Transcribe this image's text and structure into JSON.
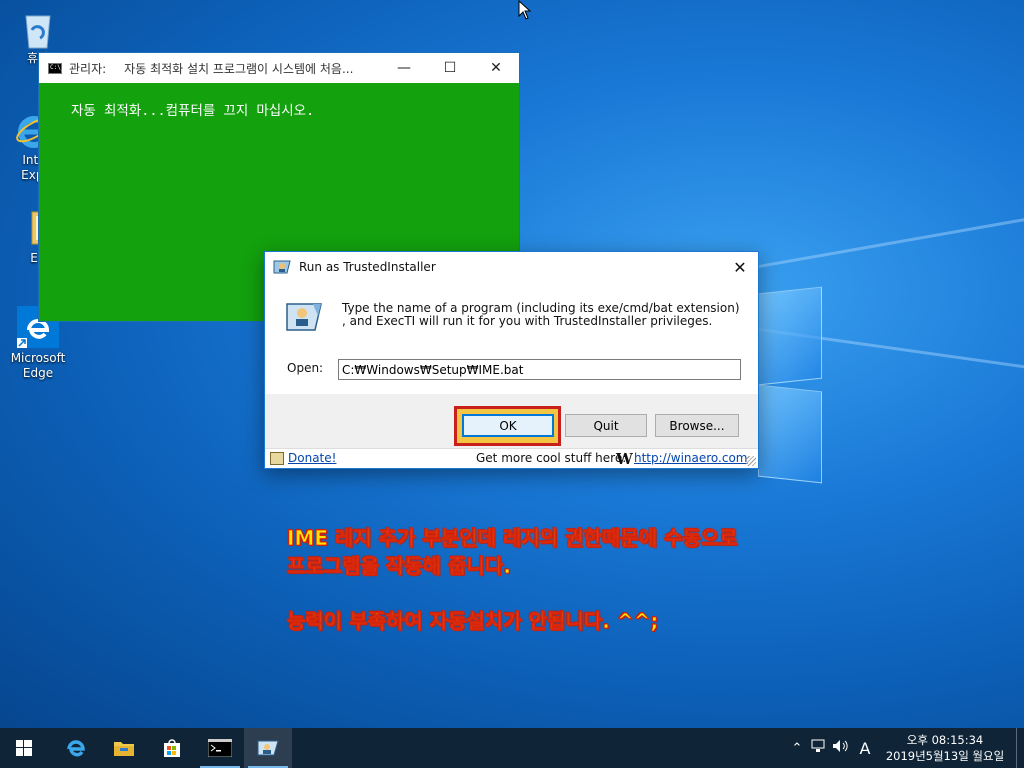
{
  "desktop": {
    "icons": [
      {
        "label": "휴가"
      },
      {
        "label": "Inte\nExpl"
      },
      {
        "label": "E"
      },
      {
        "label": "Microsoft\nEdge"
      }
    ]
  },
  "console": {
    "title_admin": "관리자:",
    "title_text": "자동  최적화 설치 프로그램이 시스템에 처음...",
    "message": "자동 최적화...컴퓨터를 끄지 마십시오."
  },
  "dialog": {
    "title": "Run as TrustedInstaller",
    "description": "Type the name of a program (including its exe/cmd/bat extension) , and ExecTI will run it for you with TrustedInstaller privileges.",
    "open_label": "Open:",
    "open_value": "C:₩Windows₩Setup₩IME.bat",
    "ok_label": "OK",
    "quit_label": "Quit",
    "browse_label": "Browse...",
    "donate_label": "Donate!",
    "more_text": "Get more cool stuff here:",
    "w_logo": "W",
    "winaero_link": "http://winaero.com"
  },
  "annotation": {
    "line1": "IME 레지 추가 부분인데 레지의 권한때문에 수동으로",
    "line2": "프로그램을 작동해 줍니다.",
    "line3": "능력이 부족하여 자동설치가 안됩니다. ^^;"
  },
  "taskbar": {
    "clock_time": "오후 08:15:34",
    "clock_date": "2019년5월13일 월요일",
    "ime_indicator": "A"
  },
  "colors": {
    "console_bg": "#13a10e",
    "annotation_fill": "#ffe600",
    "annotation_stroke": "#d8290c",
    "highlight_border": "#c8201a"
  }
}
